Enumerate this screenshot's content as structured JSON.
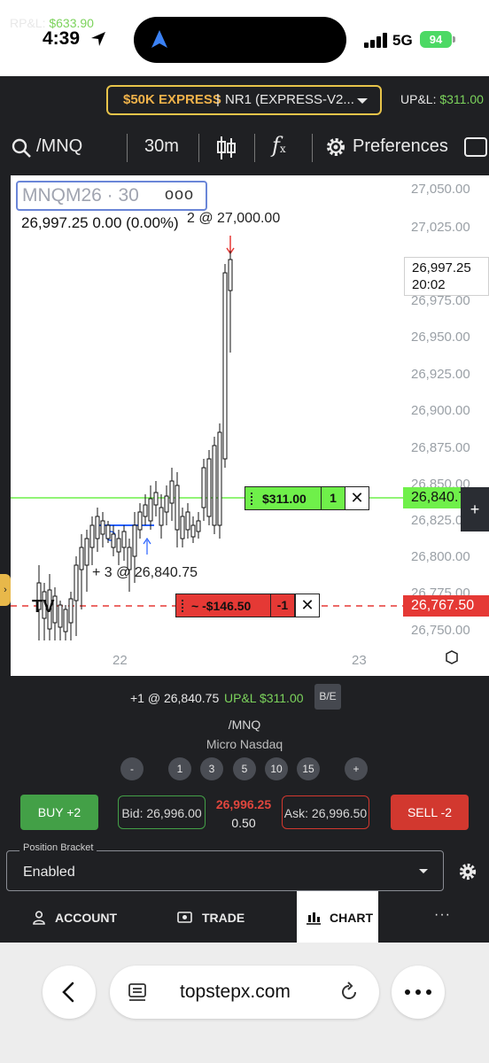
{
  "status_bar": {
    "time": "4:39",
    "network": "5G",
    "battery": "94"
  },
  "header": {
    "rp_label": "RP&L:",
    "rp_value": "$633.90",
    "account_tag": "$50K EXPRESS",
    "account_sep": "|",
    "account_name": "NR1 (EXPRESS-V2...",
    "up_label": "UP&L:",
    "up_value": "$311.00"
  },
  "toolbar": {
    "symbol": "/MNQ",
    "interval": "30m",
    "fx": "f",
    "preferences": "Preferences"
  },
  "chart": {
    "legend_symbol": "MNQM26 · 30",
    "legend_more": "ooo",
    "legend_quote": "26,997.25  0.00 (0.00%)",
    "order_top": "2 @ 27,000.00",
    "order_fill": "+ 3 @ 26,840.75",
    "price_last": "26,997.25",
    "price_countdown": "20:02",
    "price_green": "26,840.7",
    "price_red": "26,767.50",
    "pos_green_pnl": "$311.00",
    "pos_green_qty": "1",
    "pos_red_pnl": "~ -$146.50",
    "pos_red_qty": "-1",
    "close": "✕",
    "plus": "+",
    "side_tab": "›",
    "x_labels": [
      "22",
      "23"
    ],
    "y_labels": [
      "27,050.00",
      "27,025.00",
      "26,975.00",
      "26,950.00",
      "26,925.00",
      "26,900.00",
      "26,875.00",
      "26,850.00",
      "26,825.00",
      "26,800.00",
      "26,775.00",
      "26,750.00"
    ],
    "colors": {
      "up": "#111111",
      "down": "#111111",
      "green_line": "#6ff04a",
      "red_line": "#e53935"
    }
  },
  "order_panel": {
    "position_info": "+1 @ 26,840.75",
    "upl_label": "UP&L $311.00",
    "be_label": "B/E",
    "symbol": "/MNQ",
    "name": "Micro Nasdaq",
    "quantities": [
      "-",
      "1",
      "3",
      "5",
      "10",
      "15",
      "+"
    ],
    "buy_label": "BUY +2",
    "bid_label": "Bid: 26,996.00",
    "last_price": "26,996.25",
    "last_change": "0.50",
    "ask_label": "Ask: 26,996.50",
    "sell_label": "SELL -2",
    "bracket_label": "Position Bracket",
    "bracket_value": "Enabled"
  },
  "nav": {
    "account": "ACCOUNT",
    "trade": "TRADE",
    "chart": "CHART",
    "more": "···"
  },
  "browser": {
    "url": "topstepx.com"
  }
}
